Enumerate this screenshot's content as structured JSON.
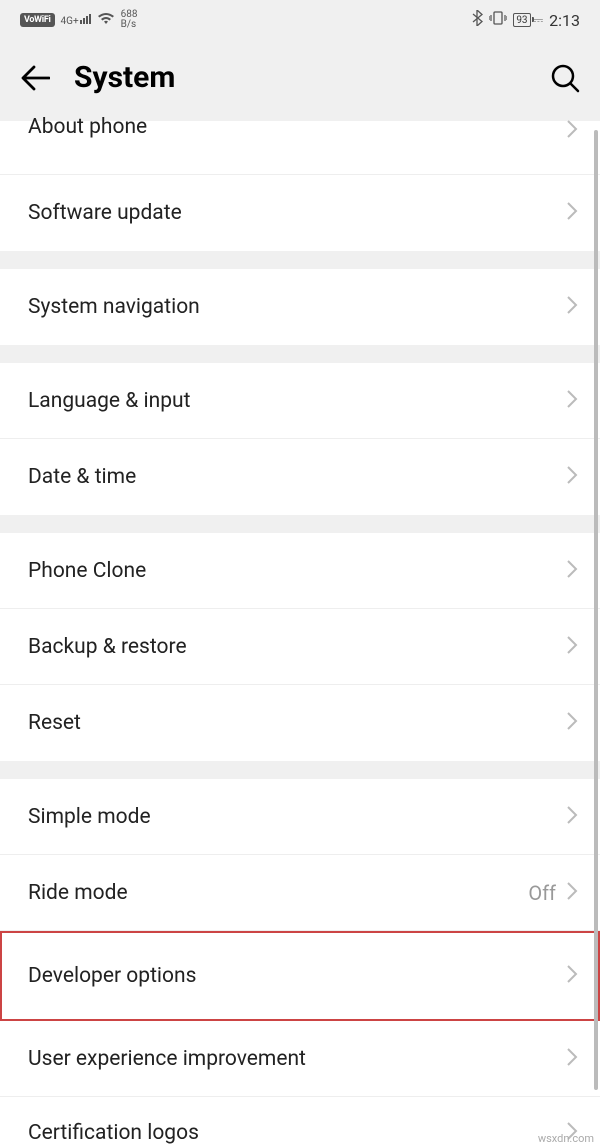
{
  "status": {
    "vowifi": "VoWiFi",
    "signal_label": "4G+",
    "speed_value": "688",
    "speed_unit": "B/s",
    "battery": "93",
    "time": "2:13"
  },
  "header": {
    "title": "System"
  },
  "sections": [
    {
      "rows": [
        {
          "id": "about-phone",
          "label": "About phone"
        },
        {
          "id": "software-update",
          "label": "Software update"
        }
      ]
    },
    {
      "rows": [
        {
          "id": "system-navigation",
          "label": "System navigation"
        }
      ]
    },
    {
      "rows": [
        {
          "id": "language-input",
          "label": "Language & input"
        },
        {
          "id": "date-time",
          "label": "Date & time"
        }
      ]
    },
    {
      "rows": [
        {
          "id": "phone-clone",
          "label": "Phone Clone"
        },
        {
          "id": "backup-restore",
          "label": "Backup & restore"
        },
        {
          "id": "reset",
          "label": "Reset"
        }
      ]
    },
    {
      "rows": [
        {
          "id": "simple-mode",
          "label": "Simple mode"
        },
        {
          "id": "ride-mode",
          "label": "Ride mode",
          "value": "Off"
        }
      ]
    },
    {
      "rows": [
        {
          "id": "developer-options",
          "label": "Developer options",
          "highlight": true
        },
        {
          "id": "user-experience",
          "label": "User experience improvement"
        },
        {
          "id": "certification-logos",
          "label": "Certification logos"
        }
      ]
    }
  ],
  "watermark": "wsxdn.com"
}
